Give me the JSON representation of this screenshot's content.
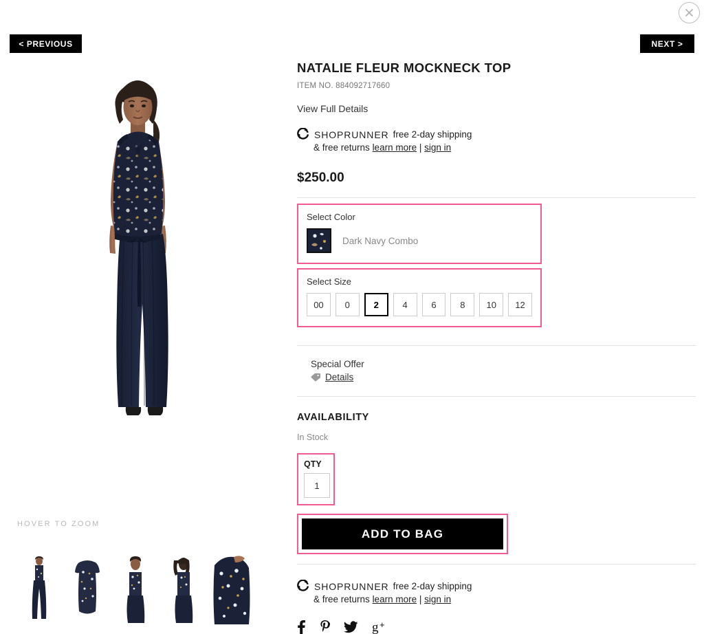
{
  "nav": {
    "previous_label": "< PREVIOUS",
    "next_label": "NEXT >",
    "close_icon": "close-circle-icon"
  },
  "gallery": {
    "hover_hint": "HOVER TO ZOOM",
    "main_image_alt": "Model wearing Natalie Fleur Mockneck Top with navy wide-leg trousers",
    "thumbnails": [
      {
        "alt": "Full length front view"
      },
      {
        "alt": "Flat lay of floral top"
      },
      {
        "alt": "Front close view with tie belt"
      },
      {
        "alt": "Back view"
      },
      {
        "alt": "Fabric detail close-up"
      }
    ]
  },
  "product": {
    "title": "NATALIE FLEUR MOCKNECK TOP",
    "item_number": "ITEM NO. 884092717660",
    "view_full_details": "View Full Details",
    "price": "$250.00"
  },
  "shoprunner": {
    "brand": "SHOPRUNNER",
    "line1_text": "free 2-day shipping",
    "line2_prefix": "& free returns",
    "learn_more": "learn more",
    "separator": "|",
    "sign_in": "sign in",
    "icon": "shoprunner-logo-icon"
  },
  "color_selector": {
    "label": "Select Color",
    "selected_color": "Dark Navy Combo",
    "swatch_icon": "color-swatch-dark-navy"
  },
  "size_selector": {
    "label": "Select Size",
    "sizes": [
      "00",
      "0",
      "2",
      "4",
      "6",
      "8",
      "10",
      "12"
    ],
    "selected_size": "2"
  },
  "special_offer": {
    "title": "Special Offer",
    "details_label": "Details",
    "icon": "tag-icon"
  },
  "availability": {
    "heading": "AVAILABILITY",
    "status": "In Stock"
  },
  "quantity": {
    "label": "QTY",
    "value": "1"
  },
  "actions": {
    "add_to_bag": "ADD TO BAG"
  },
  "social": {
    "items": [
      {
        "name": "facebook-icon",
        "glyph": "f"
      },
      {
        "name": "pinterest-icon",
        "glyph": "P"
      },
      {
        "name": "twitter-icon",
        "glyph": "t"
      },
      {
        "name": "googleplus-icon",
        "glyph": "g+"
      }
    ]
  },
  "colors": {
    "annotation_pink": "#f25a94",
    "button_black": "#000000",
    "divider_gray": "#e2e2e2",
    "muted_text": "#888888",
    "navy_garment": "#1b2238"
  }
}
